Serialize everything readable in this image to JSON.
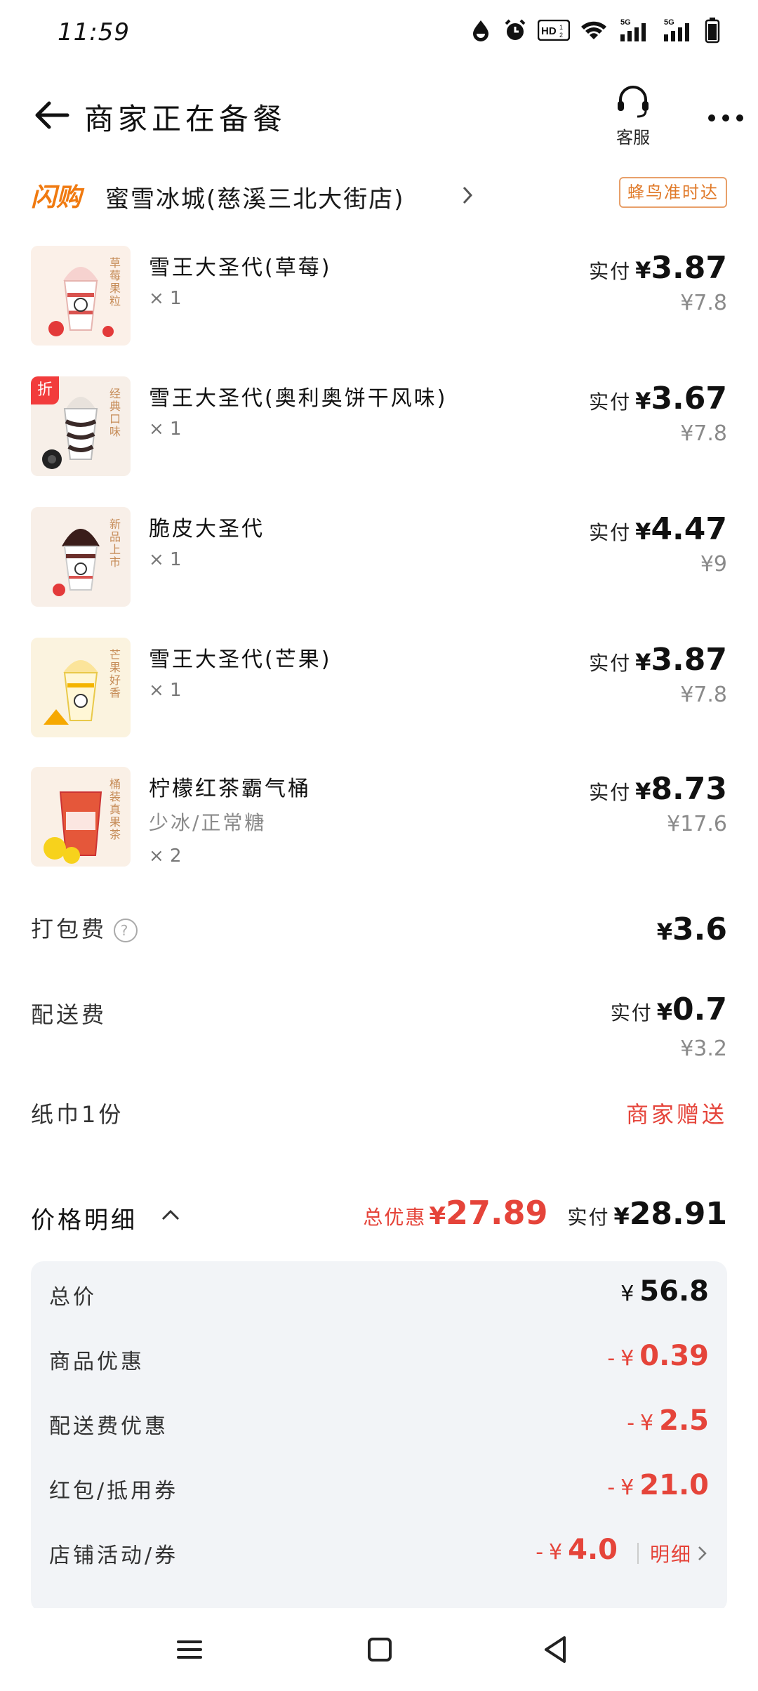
{
  "status": {
    "time": "11:59",
    "icons": [
      "data-saver-icon",
      "alarm-icon",
      "hd-icon",
      "wifi-icon",
      "signal-5g-icon",
      "signal-5g-icon",
      "battery-icon"
    ]
  },
  "header": {
    "title": "商家正在备餐",
    "service_label": "客服"
  },
  "store": {
    "flash_tag": "闪购",
    "name": "蜜雪冰城(慈溪三北大街店)",
    "delivery_badge": "蜂鸟准时达"
  },
  "items": [
    {
      "name": "雪王大圣代(草莓)",
      "spec": "",
      "qty": "× 1",
      "paid_label": "实付",
      "paid": "3.87",
      "original": "¥7.8",
      "thumb_text": "草莓果粒",
      "discount": ""
    },
    {
      "name": "雪王大圣代(奥利奥饼干风味)",
      "spec": "",
      "qty": "× 1",
      "paid_label": "实付",
      "paid": "3.67",
      "original": "¥7.8",
      "thumb_text": "经典口味",
      "discount": "折"
    },
    {
      "name": "脆皮大圣代",
      "spec": "",
      "qty": "× 1",
      "paid_label": "实付",
      "paid": "4.47",
      "original": "¥9",
      "thumb_text": "新品上市",
      "discount": ""
    },
    {
      "name": "雪王大圣代(芒果)",
      "spec": "",
      "qty": "× 1",
      "paid_label": "实付",
      "paid": "3.87",
      "original": "¥7.8",
      "thumb_text": "芒果好香",
      "discount": ""
    },
    {
      "name": "柠檬红茶霸气桶",
      "spec": "少冰/正常糖",
      "qty": "× 2",
      "paid_label": "实付",
      "paid": "8.73",
      "original": "¥17.6",
      "thumb_text": "桶装真果茶",
      "discount": ""
    }
  ],
  "fees": {
    "packing_label": "打包费",
    "packing_amount": "3.6",
    "delivery_label": "配送费",
    "delivery_paid_label": "实付",
    "delivery_paid": "0.7",
    "delivery_original": "¥3.2",
    "napkin_label": "纸巾1份",
    "napkin_note": "商家赠送"
  },
  "price_detail": {
    "title": "价格明细",
    "total_saved_label": "总优惠",
    "total_saved": "27.89",
    "total_paid_label": "实付",
    "total_paid": "28.91",
    "rows": [
      {
        "label": "总价",
        "sign": "",
        "value": "56.8"
      },
      {
        "label": "商品优惠",
        "sign": "-",
        "value": "0.39"
      },
      {
        "label": "配送费优惠",
        "sign": "-",
        "value": "2.5"
      },
      {
        "label": "红包/抵用券",
        "sign": "-",
        "value": "21.0"
      },
      {
        "label": "店铺活动/券",
        "sign": "-",
        "value": "4.0"
      }
    ],
    "detail_link": "明细"
  },
  "currency": "¥",
  "colors": {
    "accent_red": "#e5443a",
    "flash_orange": "#f07a10",
    "muted": "#8a8a8a"
  }
}
